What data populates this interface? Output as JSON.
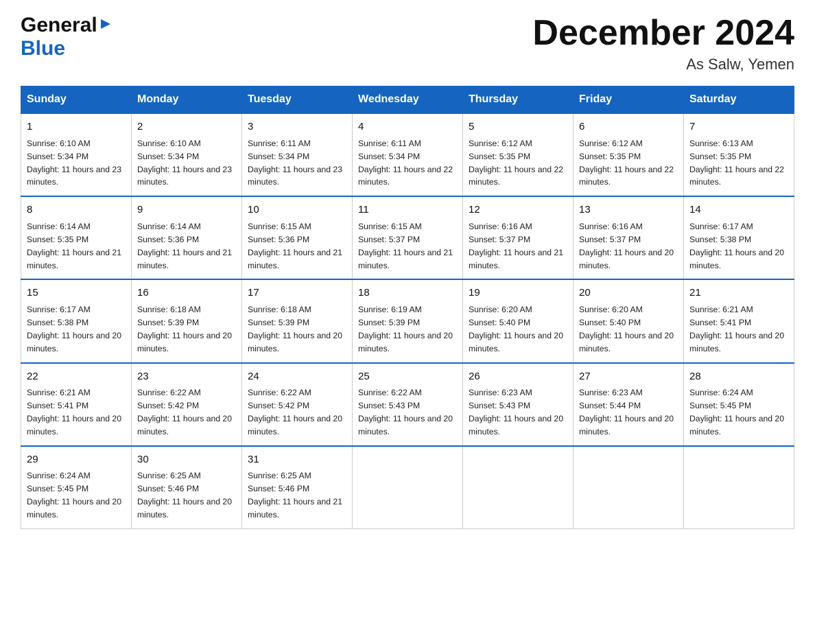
{
  "header": {
    "logo_general": "General",
    "logo_blue": "Blue",
    "month_year": "December 2024",
    "location": "As Salw, Yemen"
  },
  "days_of_week": [
    "Sunday",
    "Monday",
    "Tuesday",
    "Wednesday",
    "Thursday",
    "Friday",
    "Saturday"
  ],
  "weeks": [
    [
      {
        "day": "1",
        "sunrise": "6:10 AM",
        "sunset": "5:34 PM",
        "daylight": "11 hours and 23 minutes."
      },
      {
        "day": "2",
        "sunrise": "6:10 AM",
        "sunset": "5:34 PM",
        "daylight": "11 hours and 23 minutes."
      },
      {
        "day": "3",
        "sunrise": "6:11 AM",
        "sunset": "5:34 PM",
        "daylight": "11 hours and 23 minutes."
      },
      {
        "day": "4",
        "sunrise": "6:11 AM",
        "sunset": "5:34 PM",
        "daylight": "11 hours and 22 minutes."
      },
      {
        "day": "5",
        "sunrise": "6:12 AM",
        "sunset": "5:35 PM",
        "daylight": "11 hours and 22 minutes."
      },
      {
        "day": "6",
        "sunrise": "6:12 AM",
        "sunset": "5:35 PM",
        "daylight": "11 hours and 22 minutes."
      },
      {
        "day": "7",
        "sunrise": "6:13 AM",
        "sunset": "5:35 PM",
        "daylight": "11 hours and 22 minutes."
      }
    ],
    [
      {
        "day": "8",
        "sunrise": "6:14 AM",
        "sunset": "5:35 PM",
        "daylight": "11 hours and 21 minutes."
      },
      {
        "day": "9",
        "sunrise": "6:14 AM",
        "sunset": "5:36 PM",
        "daylight": "11 hours and 21 minutes."
      },
      {
        "day": "10",
        "sunrise": "6:15 AM",
        "sunset": "5:36 PM",
        "daylight": "11 hours and 21 minutes."
      },
      {
        "day": "11",
        "sunrise": "6:15 AM",
        "sunset": "5:37 PM",
        "daylight": "11 hours and 21 minutes."
      },
      {
        "day": "12",
        "sunrise": "6:16 AM",
        "sunset": "5:37 PM",
        "daylight": "11 hours and 21 minutes."
      },
      {
        "day": "13",
        "sunrise": "6:16 AM",
        "sunset": "5:37 PM",
        "daylight": "11 hours and 20 minutes."
      },
      {
        "day": "14",
        "sunrise": "6:17 AM",
        "sunset": "5:38 PM",
        "daylight": "11 hours and 20 minutes."
      }
    ],
    [
      {
        "day": "15",
        "sunrise": "6:17 AM",
        "sunset": "5:38 PM",
        "daylight": "11 hours and 20 minutes."
      },
      {
        "day": "16",
        "sunrise": "6:18 AM",
        "sunset": "5:39 PM",
        "daylight": "11 hours and 20 minutes."
      },
      {
        "day": "17",
        "sunrise": "6:18 AM",
        "sunset": "5:39 PM",
        "daylight": "11 hours and 20 minutes."
      },
      {
        "day": "18",
        "sunrise": "6:19 AM",
        "sunset": "5:39 PM",
        "daylight": "11 hours and 20 minutes."
      },
      {
        "day": "19",
        "sunrise": "6:20 AM",
        "sunset": "5:40 PM",
        "daylight": "11 hours and 20 minutes."
      },
      {
        "day": "20",
        "sunrise": "6:20 AM",
        "sunset": "5:40 PM",
        "daylight": "11 hours and 20 minutes."
      },
      {
        "day": "21",
        "sunrise": "6:21 AM",
        "sunset": "5:41 PM",
        "daylight": "11 hours and 20 minutes."
      }
    ],
    [
      {
        "day": "22",
        "sunrise": "6:21 AM",
        "sunset": "5:41 PM",
        "daylight": "11 hours and 20 minutes."
      },
      {
        "day": "23",
        "sunrise": "6:22 AM",
        "sunset": "5:42 PM",
        "daylight": "11 hours and 20 minutes."
      },
      {
        "day": "24",
        "sunrise": "6:22 AM",
        "sunset": "5:42 PM",
        "daylight": "11 hours and 20 minutes."
      },
      {
        "day": "25",
        "sunrise": "6:22 AM",
        "sunset": "5:43 PM",
        "daylight": "11 hours and 20 minutes."
      },
      {
        "day": "26",
        "sunrise": "6:23 AM",
        "sunset": "5:43 PM",
        "daylight": "11 hours and 20 minutes."
      },
      {
        "day": "27",
        "sunrise": "6:23 AM",
        "sunset": "5:44 PM",
        "daylight": "11 hours and 20 minutes."
      },
      {
        "day": "28",
        "sunrise": "6:24 AM",
        "sunset": "5:45 PM",
        "daylight": "11 hours and 20 minutes."
      }
    ],
    [
      {
        "day": "29",
        "sunrise": "6:24 AM",
        "sunset": "5:45 PM",
        "daylight": "11 hours and 20 minutes."
      },
      {
        "day": "30",
        "sunrise": "6:25 AM",
        "sunset": "5:46 PM",
        "daylight": "11 hours and 20 minutes."
      },
      {
        "day": "31",
        "sunrise": "6:25 AM",
        "sunset": "5:46 PM",
        "daylight": "11 hours and 21 minutes."
      },
      null,
      null,
      null,
      null
    ]
  ]
}
